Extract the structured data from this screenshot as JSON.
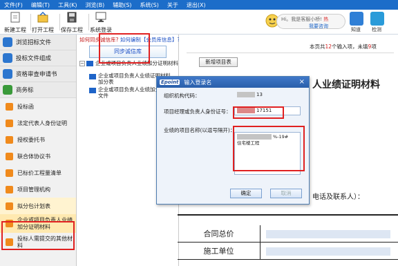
{
  "menu": [
    "文件(F)",
    "编辑(T)",
    "工具(K)",
    "浏览(B)",
    "辅助(S)",
    "系统(S)",
    "关于",
    "退出(X)"
  ],
  "toolbar": {
    "buttons": [
      "新建工程",
      "打开工程",
      "保存工程",
      "系统登录"
    ]
  },
  "help": {
    "greeting": "Hi。我是客服小桥!",
    "hot_tag": "热",
    "action": "我要咨询"
  },
  "right_buttons": [
    "知道",
    "检测"
  ],
  "sidebar": {
    "sections": [
      {
        "label": "浏览招标文件",
        "color": "#2c76cf"
      },
      {
        "label": "投标文件组成",
        "color": "#2c76cf"
      },
      {
        "label": "资格审查申请书",
        "color": "#2c76cf"
      },
      {
        "label": "商务标",
        "color": "#3a9a3a"
      }
    ],
    "items": [
      {
        "label": "投标函"
      },
      {
        "label": "法定代表人身份证明"
      },
      {
        "label": "授权委托书"
      },
      {
        "label": "联合体协议书"
      },
      {
        "label": "已标价工程量清单"
      },
      {
        "label": "项目管理机构"
      },
      {
        "label": "拟分包计划表"
      },
      {
        "label": "企业或项目负责人业绩加分证明材料"
      },
      {
        "label": "投标人需提交的其他材料"
      }
    ]
  },
  "tree": {
    "links_q1": "如何同步诚信库?",
    "links_q2": "如何编制【会员库信息】?",
    "sync_button": "同步诚信库",
    "root_label": "企业或项目负责人业绩加分证明材料",
    "children": [
      "企业或项目负责人业绩证明材料加分表",
      "企业或项目负责人业绩加分证明文件"
    ]
  },
  "main": {
    "page_info_prefix": "本页共",
    "page_info_count": "12",
    "page_info_mid": "个输入项，未填",
    "page_info_unfilled": "9",
    "page_info_suffix": "项",
    "new_project_button": "新增项目表",
    "doc_title": "人业绩证明材料",
    "doc_sub": "电话及联系人）：",
    "rows": [
      "合同总价",
      "施工单位"
    ]
  },
  "dialog": {
    "logo": "Epoint",
    "title": "输入登录名",
    "close": "×",
    "org_code_label": "组织机构代码：",
    "org_code_value": "13",
    "id_label": "项目经理或负责人身份证号：",
    "id_value": "17151",
    "proj_label": "业绩的项目名称(以逗号隔开)：",
    "proj_value_1": "%-19#",
    "proj_value_2": "住宅楼工程",
    "ok_button": "确定",
    "cancel_button": "取消"
  }
}
